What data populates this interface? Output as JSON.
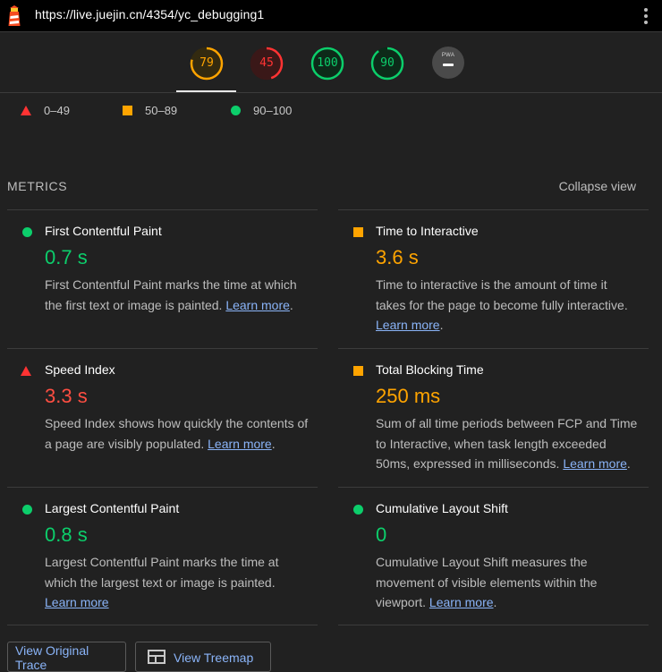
{
  "browser": {
    "url": "https://live.juejin.cn/4354/yc_debugging1"
  },
  "gauges": [
    {
      "label": "79",
      "score": 79,
      "color": "#ffa400",
      "bg": "#332a10"
    },
    {
      "label": "45",
      "score": 45,
      "color": "#ff3333",
      "bg": "#3a1818"
    },
    {
      "label": "100",
      "score": 100,
      "color": "#0cce6b",
      "bg": "#0d2a19"
    },
    {
      "label": "90",
      "score": 90,
      "color": "#0cce6b",
      "bg": "#0d2a19"
    }
  ],
  "pwa": {
    "label": "PWA"
  },
  "legend": [
    {
      "shape": "triangle",
      "label": "0–49"
    },
    {
      "shape": "square",
      "label": "50–89"
    },
    {
      "shape": "circle",
      "label": "90–100"
    }
  ],
  "metrics_header": {
    "title": "METRICS",
    "collapse_label": "Collapse view"
  },
  "metrics": [
    {
      "title": "First Contentful Paint",
      "value": "0.7 s",
      "rating": "good",
      "description": "First Contentful Paint marks the time at which the first text or image is painted.",
      "link": "Learn more"
    },
    {
      "title": "Time to Interactive",
      "value": "3.6 s",
      "rating": "average",
      "description": "Time to interactive is the amount of time it takes for the page to become fully interactive.",
      "link": "Learn more"
    },
    {
      "title": "Speed Index",
      "value": "3.3 s",
      "rating": "poor",
      "description": "Speed Index shows how quickly the contents of a page are visibly populated.",
      "link": "Learn more"
    },
    {
      "title": "Total Blocking Time",
      "value": "250 ms",
      "rating": "average",
      "description": "Sum of all time periods between FCP and Time to Interactive, when task length exceeded 50ms, expressed in milliseconds.",
      "link": "Learn more"
    },
    {
      "title": "Largest Contentful Paint",
      "value": "0.8 s",
      "rating": "good",
      "description": "Largest Contentful Paint marks the time at which the largest text or image is painted.",
      "link": "Learn more"
    },
    {
      "title": "Cumulative Layout Shift",
      "value": "0",
      "rating": "good",
      "description": "Cumulative Layout Shift measures the movement of visible elements within the viewport.",
      "link": "Learn more"
    }
  ],
  "buttons": {
    "view_trace": "View Original Trace",
    "view_treemap": "View Treemap"
  }
}
